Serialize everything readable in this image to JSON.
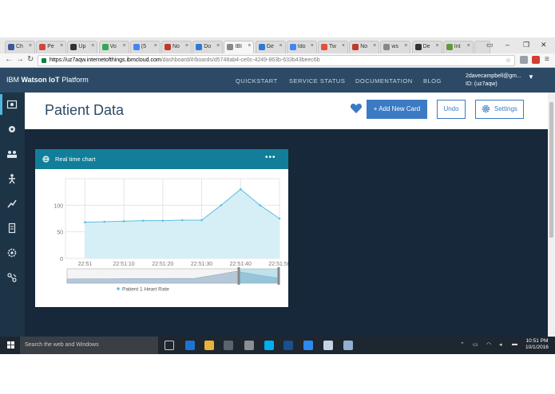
{
  "browser": {
    "tabs": [
      {
        "label": "Ch",
        "color": "#3b5998"
      },
      {
        "label": "Pe",
        "color": "#d44638"
      },
      {
        "label": "Up",
        "color": "#333333"
      },
      {
        "label": "Vo",
        "color": "#34a853"
      },
      {
        "label": "(5",
        "color": "#4285f4"
      },
      {
        "label": "No",
        "color": "#c0392b"
      },
      {
        "label": "Do",
        "color": "#2c7ad6"
      },
      {
        "label": "IBI",
        "color": "#888888"
      },
      {
        "label": "Ge",
        "color": "#2c7ad6"
      },
      {
        "label": "Ido",
        "color": "#4285f4"
      },
      {
        "label": "Tw",
        "color": "#e74c3c"
      },
      {
        "label": "No",
        "color": "#c0392b"
      },
      {
        "label": "ws",
        "color": "#888888"
      },
      {
        "label": "De",
        "color": "#333333"
      },
      {
        "label": "Int",
        "color": "#5d9b3b"
      }
    ],
    "tab_close": "×",
    "url_host": "https://uz7aqw.internetofthings.ibmcloud.com",
    "url_path": "/dashboard/#/boards/d5748ab4-ce0c-4249-863b-633b43beec6b"
  },
  "app": {
    "brand_prefix": "IBM ",
    "brand_bold": "Watson IoT",
    "brand_suffix": " Platform",
    "nav": [
      "QUICKSTART",
      "SERVICE STATUS",
      "DOCUMENTATION",
      "BLOG"
    ],
    "user_email": "2davecampbell@gm...",
    "user_id": "ID: (uz7aqw)",
    "accent": "#3b7bc4",
    "header_color": "#2c4a66"
  },
  "sidebar_icons": [
    "boards-icon",
    "devices-icon",
    "members-icon",
    "apps-icon",
    "rules-icon",
    "usage-icon",
    "security-icon",
    "extensions-icon"
  ],
  "page": {
    "title": "Patient Data",
    "add_card_label": "+ Add New Card",
    "undo_label": "Undo",
    "settings_label": "Settings"
  },
  "card": {
    "title": "Real time chart",
    "menu": "•••"
  },
  "chart_data": {
    "type": "area",
    "x": [
      "22:51:00",
      "22:51:05",
      "22:51:10",
      "22:51:15",
      "22:51:20",
      "22:51:25",
      "22:51:30",
      "22:51:35",
      "22:51:40",
      "22:51:45",
      "22:51:50"
    ],
    "series": [
      {
        "name": "Patient 1 Heart Rate",
        "values": [
          68,
          69,
          70,
          71,
          71,
          72,
          72,
          100,
          130,
          100,
          75
        ],
        "color": "#5bc0de"
      }
    ],
    "xticks": [
      "22:51",
      "22:51:10",
      "22:51:20",
      "22:51:30",
      "22:51:40",
      "22:51:50"
    ],
    "yticks": [
      "0",
      "50",
      "100"
    ],
    "ylim": [
      0,
      150
    ],
    "grid": true,
    "legend": "bottom"
  },
  "taskbar": {
    "search_placeholder": "Search the web and Windows",
    "time": "10:51 PM",
    "date": "10/1/2016"
  }
}
